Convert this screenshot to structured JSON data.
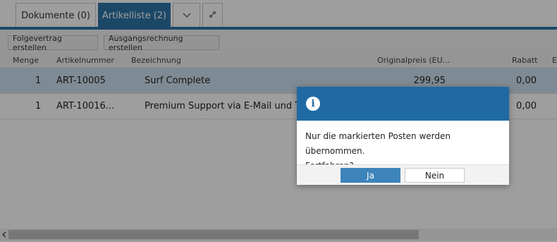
{
  "tabs": [
    {
      "label": "Dokumente (0)",
      "active": false
    },
    {
      "label": "Artikelliste (2)",
      "active": true
    }
  ],
  "tab_icons": [
    "chevron-down-icon",
    "expand-icon"
  ],
  "toolbar": {
    "followup_contract_label": "Folgevertrag erstellen",
    "outgoing_invoice_label": "Ausgangsrechnung erstellen"
  },
  "table": {
    "columns": [
      "Menge",
      "Artikelnummer",
      "Bezeichnung",
      "Originalpreis (EU...",
      "Rabatt",
      "E"
    ],
    "rows": [
      {
        "menge": "1",
        "artikelnummer": "ART-10005",
        "bezeichnung": "Surf Complete",
        "originalpreis": "299,95",
        "rabatt": "0,00",
        "selected": true
      },
      {
        "menge": "1",
        "artikelnummer": "ART-10016...",
        "bezeichnung": "Premium Support via E-Mail und T",
        "originalpreis": "",
        "rabatt": "0,00",
        "selected": false
      }
    ]
  },
  "dialog": {
    "icon": "info-icon",
    "message_line1": "Nur die markierten Posten werden übernommen.",
    "message_line2": "Fortfahren?",
    "yes_label": "Ja",
    "no_label": "Nein"
  },
  "colors": {
    "accent": "#2e74a8",
    "dialog_header": "#1f6aa3",
    "selected_row": "#cde0ef",
    "primary_button": "#3d84bb"
  }
}
